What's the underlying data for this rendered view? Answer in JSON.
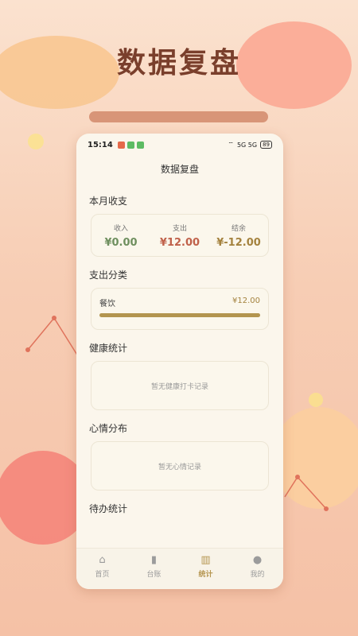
{
  "promo_title": "数据复盘",
  "status_bar": {
    "time": "15:14",
    "signal": "5G 5G",
    "battery": "89"
  },
  "page": {
    "title": "数据复盘"
  },
  "sections": {
    "monthly": {
      "title": "本月收支",
      "income_label": "收入",
      "income_value": "¥0.00",
      "expense_label": "支出",
      "expense_value": "¥12.00",
      "balance_label": "结余",
      "balance_value": "¥-12.00"
    },
    "categories": {
      "title": "支出分类",
      "items": [
        {
          "name": "餐饮",
          "amount": "¥12.00",
          "fraction": 1.0
        }
      ]
    },
    "health": {
      "title": "健康统计",
      "empty_text": "暂无健康打卡记录"
    },
    "mood": {
      "title": "心情分布",
      "empty_text": "暂无心情记录"
    },
    "todo": {
      "title": "待办统计"
    }
  },
  "tabs": [
    {
      "label": "首页",
      "icon": "home-icon",
      "active": false
    },
    {
      "label": "台账",
      "icon": "book-icon",
      "active": false
    },
    {
      "label": "统计",
      "icon": "chart-icon",
      "active": true
    },
    {
      "label": "我的",
      "icon": "user-icon",
      "active": false
    }
  ],
  "colors": {
    "income": "#6e8f5e",
    "expense": "#c0614a",
    "balance": "#a4823e",
    "accent": "#b5954f"
  }
}
